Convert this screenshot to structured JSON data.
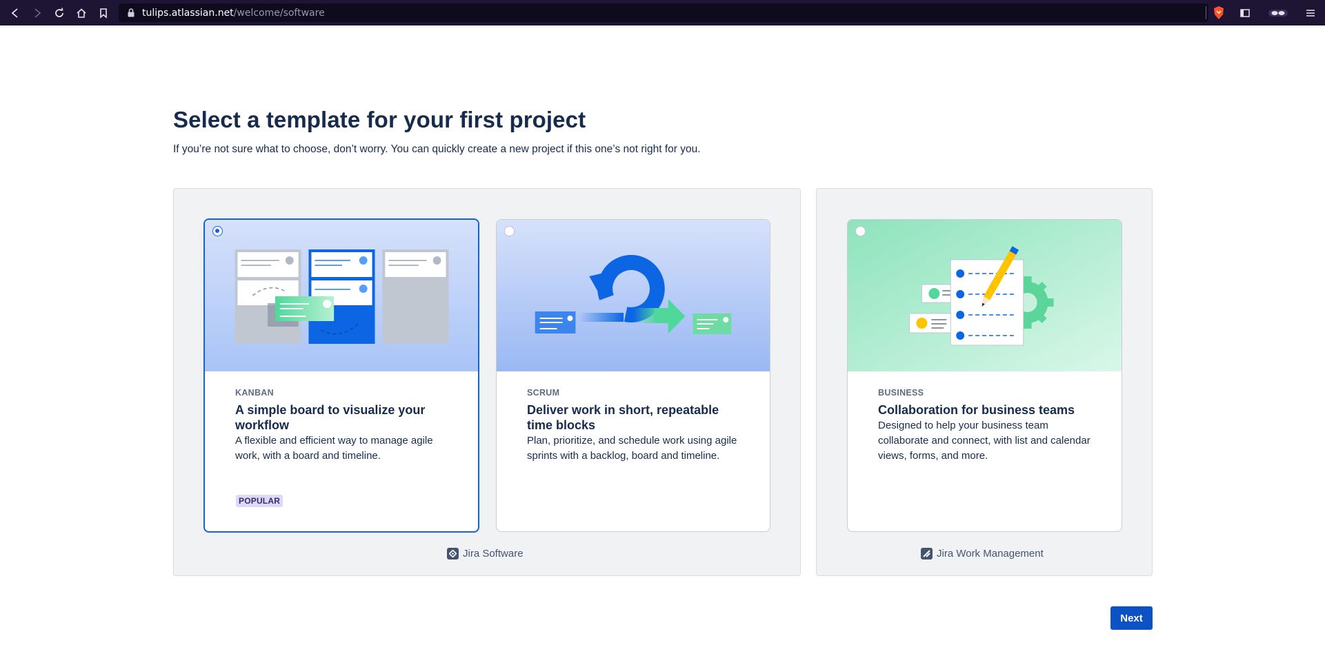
{
  "browser": {
    "url_host": "tulips.atlassian.net",
    "url_path": "/welcome/software"
  },
  "page": {
    "title": "Select a template for your first project",
    "subtitle": "If you’re not sure what to choose, don’t worry. You can quickly create a new project if this one’s not right for you."
  },
  "groups": [
    {
      "product": "Jira Software"
    },
    {
      "product": "Jira Work Management"
    }
  ],
  "cards": [
    {
      "label": "KANBAN",
      "heading": "A simple board to visualize your workflow",
      "description": "A flexible and efficient way to manage agile work, with a board and timeline.",
      "badge": "POPULAR",
      "selected": true
    },
    {
      "label": "SCRUM",
      "heading": "Deliver work in short, repeatable time blocks",
      "description": "Plan, prioritize, and schedule work using agile sprints with a backlog, board and timeline.",
      "selected": false
    },
    {
      "label": "BUSINESS",
      "heading": "Collaboration for business teams",
      "description": "Designed to help your business team collaborate and connect, with list and calendar views, forms, and more.",
      "selected": false
    }
  ],
  "actions": {
    "next_label": "Next"
  },
  "colors": {
    "primary": "#0c66e4",
    "button": "#0c52c4",
    "text": "#172B4D",
    "badge_bg": "#dfd8fd"
  }
}
